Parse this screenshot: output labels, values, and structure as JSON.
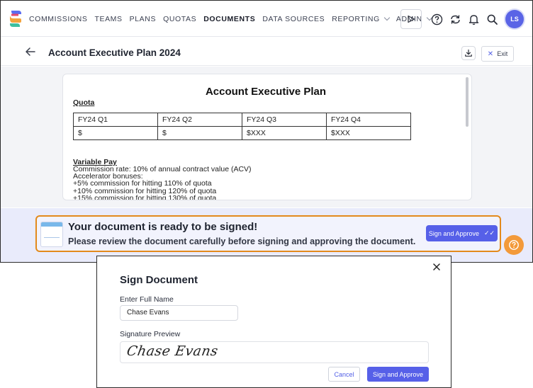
{
  "nav": {
    "items": [
      {
        "label": "COMMISSIONS",
        "active": false,
        "dropdown": false
      },
      {
        "label": "TEAMS",
        "active": false,
        "dropdown": false
      },
      {
        "label": "PLANS",
        "active": false,
        "dropdown": false
      },
      {
        "label": "QUOTAS",
        "active": false,
        "dropdown": false
      },
      {
        "label": "DOCUMENTS",
        "active": true,
        "dropdown": false
      },
      {
        "label": "DATA SOURCES",
        "active": false,
        "dropdown": false
      },
      {
        "label": "REPORTING",
        "active": false,
        "dropdown": true
      },
      {
        "label": "ADMIN",
        "active": false,
        "dropdown": true
      }
    ],
    "icons": [
      "send-icon",
      "help-icon",
      "sync-icon",
      "bell-icon",
      "search-icon"
    ],
    "avatar_initials": "LS"
  },
  "page": {
    "title": "Account Executive Plan 2024",
    "exit_label": "Exit"
  },
  "document": {
    "title": "Account Executive Plan",
    "quota_heading": "Quota",
    "quota_table": {
      "headers": [
        "FY24 Q1",
        "FY24 Q2",
        "FY24 Q3",
        "FY24 Q4"
      ],
      "values": [
        "$",
        "$",
        "$XXX",
        "$XXX"
      ]
    },
    "variable_pay_heading": "Variable Pay",
    "variable_pay_lines": [
      "Commission rate: 10% of annual contract value (ACV)",
      "Accelerator bonuses:",
      "+5% commission for hitting 110% of quota",
      "+10% commission for hitting 120% of quota",
      "+15% commission for hitting 130% of quota"
    ]
  },
  "banner": {
    "title": "Your document is ready to be signed!",
    "subtitle": "Please review the document carefully before signing and approving the document.",
    "button_label": "Sign and Approve"
  },
  "modal": {
    "title": "Sign Document",
    "name_label": "Enter Full Name",
    "name_value": "Chase Evans",
    "preview_label": "Signature Preview",
    "signature_text": "Chase Evans",
    "cancel_label": "Cancel",
    "submit_label": "Sign and Approve"
  },
  "colors": {
    "accent": "#5660e8",
    "banner_border": "#e38a1c",
    "help_fab": "#f39a3a"
  }
}
